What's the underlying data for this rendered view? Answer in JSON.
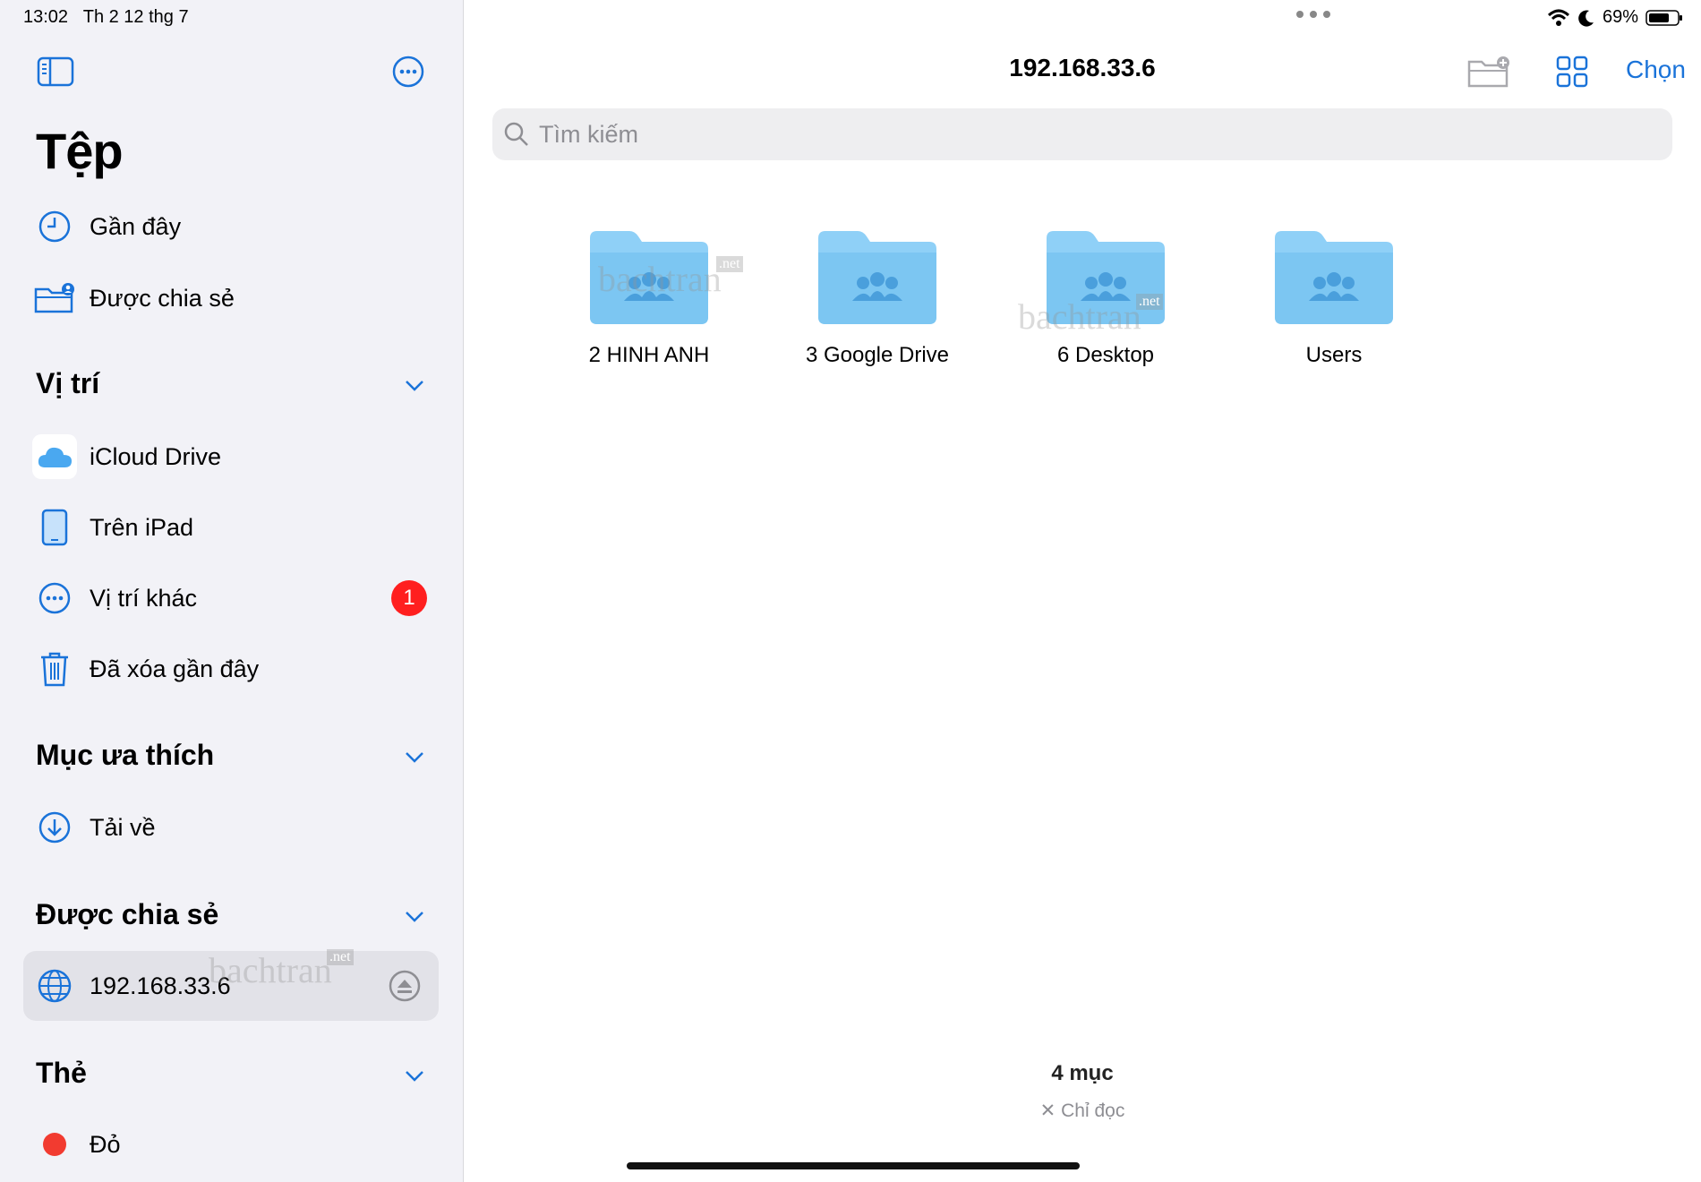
{
  "status": {
    "time": "13:02",
    "date": "Th 2 12 thg 7",
    "battery": "69%"
  },
  "sidebar": {
    "title": "Tệp",
    "recent": "Gần đây",
    "shared": "Được chia sẻ",
    "locations": {
      "header": "Vị trí",
      "items": [
        "iCloud Drive",
        "Trên iPad",
        "Vị trí khác",
        "Đã xóa gần đây"
      ],
      "badge": "1"
    },
    "favorites": {
      "header": "Mục ưa thích",
      "items": [
        "Tải về"
      ]
    },
    "shared_section": {
      "header": "Được chia sẻ",
      "server": "192.168.33.6"
    },
    "tags": {
      "header": "Thẻ",
      "items": [
        "Đỏ"
      ]
    }
  },
  "main": {
    "title": "192.168.33.6",
    "select_label": "Chọn",
    "search_placeholder": "Tìm kiếm",
    "folders": [
      "2 HINH ANH",
      "3 Google Drive",
      "6 Desktop",
      "Users"
    ],
    "item_count": "4 mục",
    "read_only": "Chỉ đọc"
  },
  "watermark": "bachtran",
  "watermark_suffix": ".net",
  "colors": {
    "accent": "#1a73d9",
    "folder": "#8fd0f7",
    "badge": "#ff1f1f",
    "tag_red": "#f23b30"
  }
}
